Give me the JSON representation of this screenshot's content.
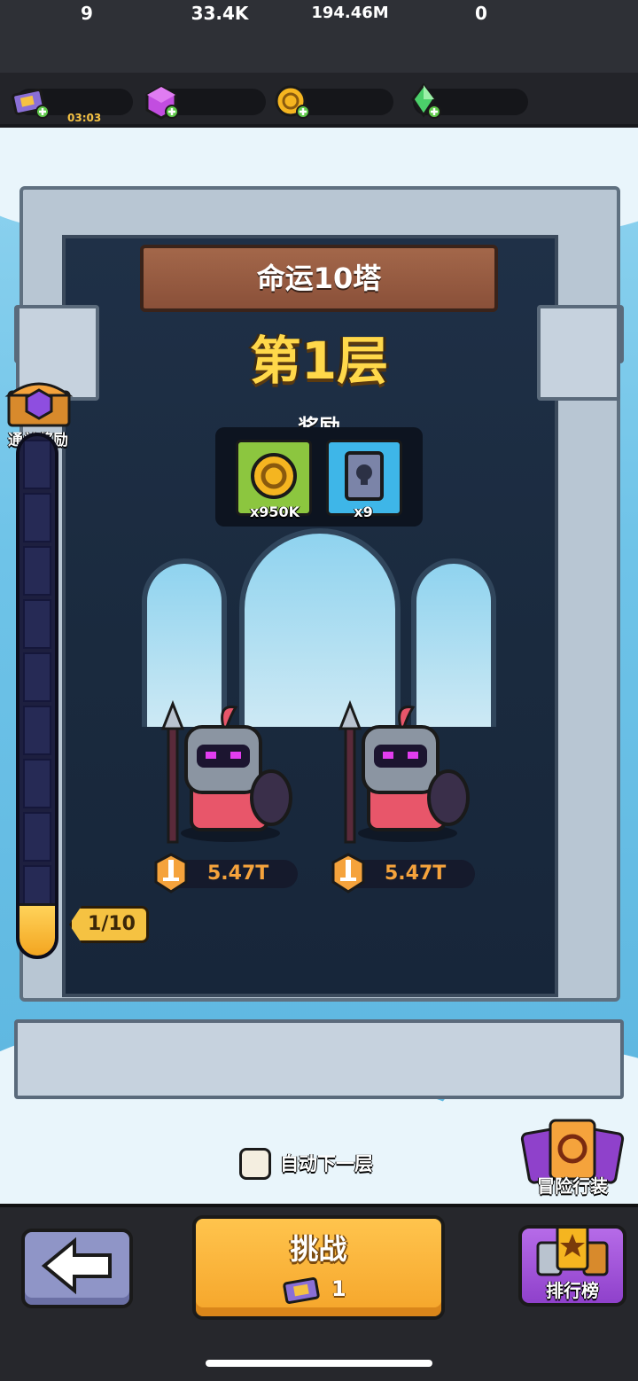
{
  "resources": {
    "tickets": {
      "icon": "ticket-plus-icon",
      "value": "9",
      "timer": "03:03"
    },
    "gems": {
      "icon": "purple-gem-plus-icon",
      "value": "33.4K"
    },
    "gold": {
      "icon": "gold-coin-plus-icon",
      "value": "194.46M"
    },
    "crystals": {
      "icon": "green-crystal-plus-icon",
      "value": "0"
    }
  },
  "tower": {
    "name": "命运10塔",
    "floor_title": "第1层"
  },
  "rewards": {
    "label": "奖励",
    "items": [
      {
        "icon": "gold-coin-icon",
        "qty": "x950K",
        "bg": "#8cc63f"
      },
      {
        "icon": "skull-book-icon",
        "qty": "x9",
        "bg": "#3eb6e8"
      }
    ]
  },
  "clear_reward": {
    "icon": "treasure-chest-icon",
    "label": "通关奖励"
  },
  "progress": {
    "current": 1,
    "total": 10,
    "label": "1/10"
  },
  "enemies": [
    {
      "name": "knight-enemy",
      "power": "5.47T"
    },
    {
      "name": "knight-enemy",
      "power": "5.47T"
    }
  ],
  "auto_next": {
    "label": "自动下一层",
    "checked": false
  },
  "adventure_gear": {
    "icon": "card-swap-icon",
    "label": "冒险行装"
  },
  "buttons": {
    "back": {
      "icon": "back-arrow-icon"
    },
    "challenge": {
      "label": "挑战",
      "cost": "1",
      "cost_icon": "ticket-icon"
    },
    "ranking": {
      "icon": "star-trophy-icon",
      "label": "排行榜"
    }
  },
  "colors": {
    "accent_gold": "#f5c242",
    "power_orange": "#f5a33c",
    "tower_stone": "#b8c6d3",
    "progress_fill": "#f3a520"
  }
}
